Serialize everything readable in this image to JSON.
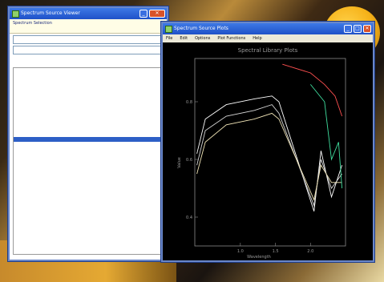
{
  "left_window": {
    "title": "Spectrum Source Viewer",
    "header_line1": "Spectrum Selection",
    "header_line2": "",
    "input1": "",
    "input2": "",
    "list_items": [
      "",
      "",
      "",
      "",
      "",
      "",
      "",
      "",
      "",
      "",
      "",
      "",
      "",
      ""
    ],
    "selected_index": 13
  },
  "right_window": {
    "title": "Spectrum Source Plots",
    "menu": [
      "File",
      "Edit",
      "Options",
      "Plot Functions",
      "Help"
    ],
    "plot_title": "Spectral Library Plots",
    "ylabel": "Value",
    "xlabel": "Wavelength",
    "legend": [
      "",
      "",
      ""
    ]
  },
  "chart_data": {
    "type": "line",
    "title": "Spectral Library Plots",
    "xlabel": "Wavelength",
    "ylabel": "Value",
    "xlim": [
      0.35,
      2.5
    ],
    "ylim": [
      0.3,
      0.95
    ],
    "xticks": [
      "1.0",
      "1.5",
      "2.0"
    ],
    "yticks": [
      "0.8",
      "0.6",
      "0.4"
    ],
    "series": [
      {
        "color": "#ffffff",
        "x": [
          0.38,
          0.5,
          0.8,
          1.2,
          1.45,
          1.55,
          2.05,
          2.15,
          2.3,
          2.45
        ],
        "y": [
          0.62,
          0.74,
          0.79,
          0.81,
          0.82,
          0.8,
          0.42,
          0.63,
          0.47,
          0.58
        ]
      },
      {
        "color": "#d8d8d8",
        "x": [
          0.38,
          0.5,
          0.8,
          1.2,
          1.45,
          1.55,
          2.05,
          2.15,
          2.3,
          2.45
        ],
        "y": [
          0.58,
          0.7,
          0.75,
          0.77,
          0.79,
          0.76,
          0.44,
          0.6,
          0.5,
          0.55
        ]
      },
      {
        "color": "#f2e6b8",
        "x": [
          0.38,
          0.5,
          0.8,
          1.2,
          1.45,
          1.55,
          2.05,
          2.15,
          2.3,
          2.45
        ],
        "y": [
          0.55,
          0.66,
          0.72,
          0.74,
          0.76,
          0.74,
          0.46,
          0.58,
          0.52,
          0.52
        ]
      },
      {
        "color": "#ff5050",
        "x": [
          1.6,
          2.0,
          2.2,
          2.35,
          2.45
        ],
        "y": [
          0.93,
          0.9,
          0.86,
          0.82,
          0.75
        ]
      },
      {
        "color": "#40e0a0",
        "x": [
          2.0,
          2.2,
          2.3,
          2.4,
          2.45
        ],
        "y": [
          0.86,
          0.8,
          0.6,
          0.66,
          0.5
        ]
      }
    ]
  },
  "colors": {
    "titlebar": "#1f51c8",
    "selection": "#2d5fc6",
    "plot_bg": "#000000"
  }
}
